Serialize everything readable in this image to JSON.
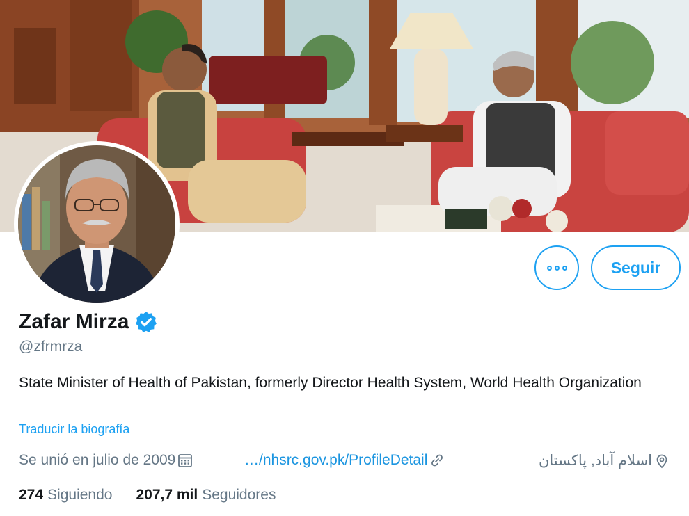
{
  "profile": {
    "name": "Zafar Mirza",
    "handle": "@zfrmrza",
    "bio": "State Minister of Health of Pakistan, formerly Director Health System, World Health Organization",
    "translate_bio": "Traducir la biografía",
    "joined": "Se unió en julio de 2009",
    "website": "…/nhsrc.gov.pk/ProfileDetail",
    "location": "اسلام آباد, پاکستان",
    "verified": true
  },
  "actions": {
    "follow_label": "Seguir",
    "more_icon": "more-options-icon"
  },
  "stats": {
    "following_count": "274",
    "following_label": "Siguiendo",
    "followers_count": "207,7 mil",
    "followers_label": "Seguidores"
  },
  "colors": {
    "accent": "#1da1f2",
    "secondary_text": "#657786",
    "primary_text": "#14171a"
  },
  "icons": [
    "verified-badge-icon",
    "calendar-icon",
    "link-icon",
    "location-pin-icon"
  ]
}
